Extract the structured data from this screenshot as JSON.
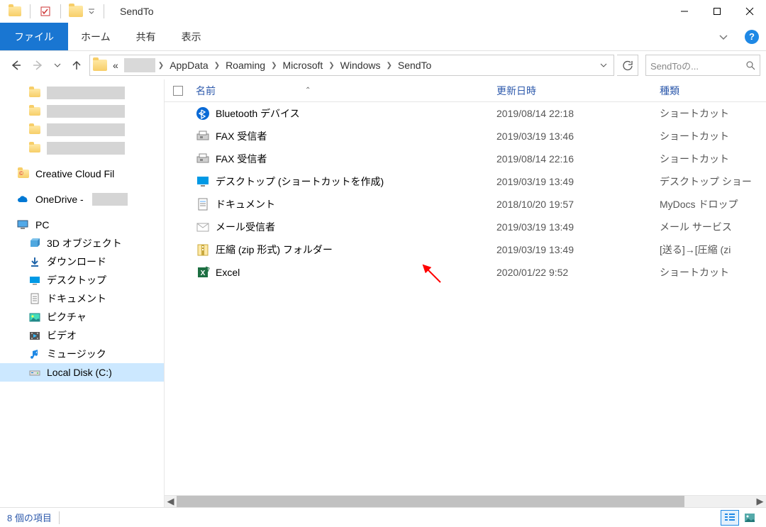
{
  "window": {
    "title": "SendTo"
  },
  "ribbon": {
    "file": "ファイル",
    "tabs": [
      "ホーム",
      "共有",
      "表示"
    ]
  },
  "breadcrumb": {
    "leading": "«",
    "items": [
      "AppData",
      "Roaming",
      "Microsoft",
      "Windows",
      "SendTo"
    ]
  },
  "search": {
    "placeholder": "SendToの..."
  },
  "sidebar": {
    "quick": [
      {
        "label": ""
      },
      {
        "label": ""
      },
      {
        "label": ""
      },
      {
        "label": ""
      }
    ],
    "creative": "Creative Cloud Fil",
    "onedrive": "OneDrive -",
    "pc": "PC",
    "pc_items": [
      "3D オブジェクト",
      "ダウンロード",
      "デスクトップ",
      "ドキュメント",
      "ピクチャ",
      "ビデオ",
      "ミュージック",
      "Local Disk (C:)"
    ]
  },
  "columns": {
    "name": "名前",
    "date": "更新日時",
    "type": "種類"
  },
  "files": [
    {
      "icon": "bluetooth",
      "name": "Bluetooth デバイス",
      "date": "2019/08/14 22:18",
      "type": "ショートカット"
    },
    {
      "icon": "fax",
      "name": "FAX 受信者",
      "date": "2019/03/19 13:46",
      "type": "ショートカット"
    },
    {
      "icon": "fax",
      "name": "FAX 受信者",
      "date": "2019/08/14 22:16",
      "type": "ショートカット"
    },
    {
      "icon": "desktop",
      "name": "デスクトップ (ショートカットを作成)",
      "date": "2019/03/19 13:49",
      "type": "デスクトップ ショー"
    },
    {
      "icon": "doc",
      "name": "ドキュメント",
      "date": "2018/10/20 19:57",
      "type": "MyDocs ドロップ"
    },
    {
      "icon": "mail",
      "name": "メール受信者",
      "date": "2019/03/19 13:49",
      "type": "メール サービス"
    },
    {
      "icon": "zip",
      "name": "圧縮 (zip 形式) フォルダー",
      "date": "2019/03/19 13:49",
      "type": "[送る]→[圧縮 (zi"
    },
    {
      "icon": "excel",
      "name": "Excel",
      "date": "2020/01/22 9:52",
      "type": "ショートカット"
    }
  ],
  "status": {
    "count": "8 個の項目"
  }
}
